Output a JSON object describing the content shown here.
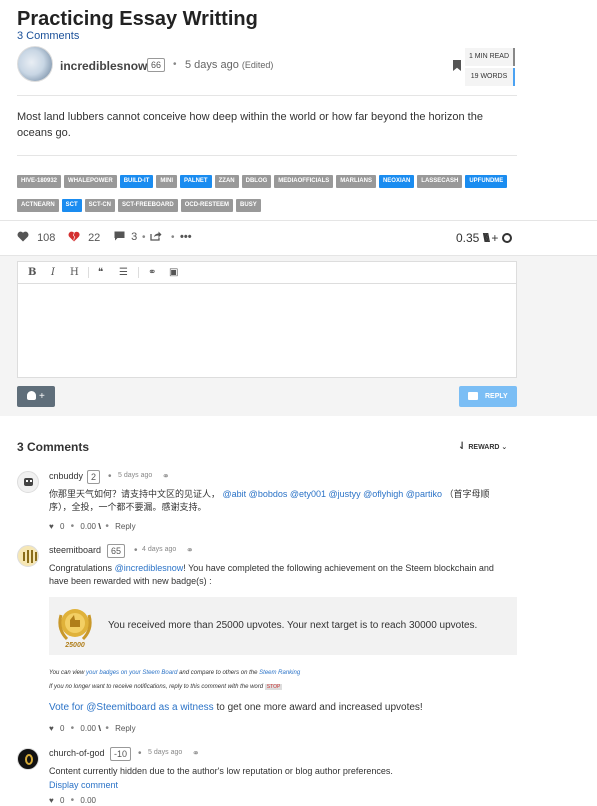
{
  "post": {
    "title": "Practicing Essay Writting",
    "comments_link": "3 Comments",
    "author": "incrediblesnow",
    "reputation": "66",
    "time": "5 days ago",
    "edited": "(Edited)",
    "read_time": "1 MIN READ",
    "word_count": "19 WORDS",
    "body": "Most land lubbers cannot conceive how deep within the world or how far beyond the horizon the oceans go.",
    "tags": [
      {
        "label": "HIVE-180932",
        "color": "#999999"
      },
      {
        "label": "WHALEPOWER",
        "color": "#999999"
      },
      {
        "label": "BUILD-IT",
        "color": "#1a8cf0"
      },
      {
        "label": "MINI",
        "color": "#999999"
      },
      {
        "label": "PALNET",
        "color": "#1a8cf0"
      },
      {
        "label": "ZZAN",
        "color": "#999999"
      },
      {
        "label": "DBLOG",
        "color": "#999999"
      },
      {
        "label": "MEDIAOFFICIALS",
        "color": "#999999"
      },
      {
        "label": "MARLIANS",
        "color": "#999999"
      },
      {
        "label": "NEOXIAN",
        "color": "#1a8cf0"
      },
      {
        "label": "LASSECASH",
        "color": "#999999"
      },
      {
        "label": "UPFUNDME",
        "color": "#1a8cf0"
      },
      {
        "label": "ACTNEARN",
        "color": "#999999"
      },
      {
        "label": "SCT",
        "color": "#1a8cf0"
      },
      {
        "label": "SCT-CN",
        "color": "#999999"
      },
      {
        "label": "SCT-FREEBOARD",
        "color": "#999999"
      },
      {
        "label": "OCD-RESTEEM",
        "color": "#999999"
      },
      {
        "label": "BUSY",
        "color": "#999999"
      }
    ]
  },
  "votes": {
    "upvotes": "108",
    "downvotes": "22",
    "comments": "3",
    "payout": "0.35",
    "plus": "+"
  },
  "editor": {
    "bold": "B",
    "italic": "I",
    "heading": "H",
    "quote": "❝",
    "list": "☰",
    "link": "⚭",
    "image": "▣",
    "user_button": "+",
    "reply_button": "REPLY"
  },
  "comments_section": {
    "header": "3 Comments",
    "sort_label": "REWARD"
  },
  "comments": [
    {
      "author": "cnbuddy",
      "rep": "2",
      "time": "5 days ago",
      "body_text": "你那里天气如何？请支持中文区的见证人，",
      "body_mentions": "@abit @bobdos @ety001 @justyy @oflyhigh @partiko",
      "body_suffix": "（首字母顺",
      "body_line2": "序），全投，一个都不要漏。感谢支持。",
      "votes": "0",
      "payout": "0.00",
      "reply": "Reply"
    },
    {
      "author": "steemitboard",
      "rep": "65",
      "time": "4 days ago",
      "body_prefix": "Congratulations",
      "body_mention": "@incrediblesnow",
      "body_rest": "! You have completed the following achievement on the Steem blockchain and",
      "body_line2": "have been rewarded with new badge(s) :",
      "badge_text": "You received more than 25000 upvotes. Your next target is to reach 30000 upvotes.",
      "badge_number": "25000",
      "note1_a": "You can view",
      "note1_link1": "your badges on your Steem Board",
      "note1_b": "and compare to others on the",
      "note1_link2": "Steem Ranking",
      "note2": "If you no longer want to receive notifications, reply to this comment with the word",
      "note2_stop": "STOP",
      "vote_link": "Vote for @Steemitboard as a witness",
      "vote_rest": "to get one more award and increased upvotes!",
      "votes": "0",
      "payout": "0.00",
      "reply": "Reply"
    },
    {
      "author": "church-of-god",
      "rep": "-10",
      "time": "5 days ago",
      "body": "Content currently hidden due to the author's low reputation or blog author preferences.",
      "display_link": "Display comment",
      "votes": "0",
      "payout": "0.00"
    }
  ]
}
